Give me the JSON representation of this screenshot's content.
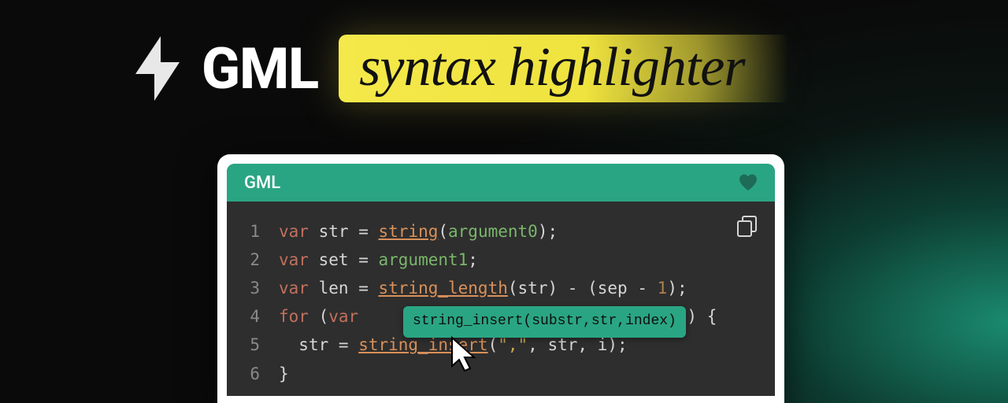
{
  "header": {
    "brand": "GML",
    "highlight": "syntax highlighter"
  },
  "panel": {
    "title": "GML",
    "tooltip": "string_insert(substr,str,index)"
  },
  "code": {
    "lines": [
      1,
      2,
      3,
      4,
      5,
      6
    ],
    "l1": {
      "kw": "var",
      "id": "str",
      "fn": "string",
      "arg": "argument0"
    },
    "l2": {
      "kw": "var",
      "id": "set",
      "arg": "argument1"
    },
    "l3": {
      "kw": "var",
      "id": "len",
      "fn": "string_length",
      "arg": "str",
      "sep": "sep",
      "num": "1"
    },
    "l4": {
      "kw": "for",
      "var": "var",
      "cond_tail": "sep) {"
    },
    "l5": {
      "id": "str",
      "fn": "string_insert",
      "s": "\",\"",
      "a2": "str",
      "a3": "i"
    },
    "l6": {
      "brace": "}"
    }
  },
  "colors": {
    "accent": "#2aa583",
    "highlight": "#f4e94a",
    "bg": "#0a0a0a"
  }
}
